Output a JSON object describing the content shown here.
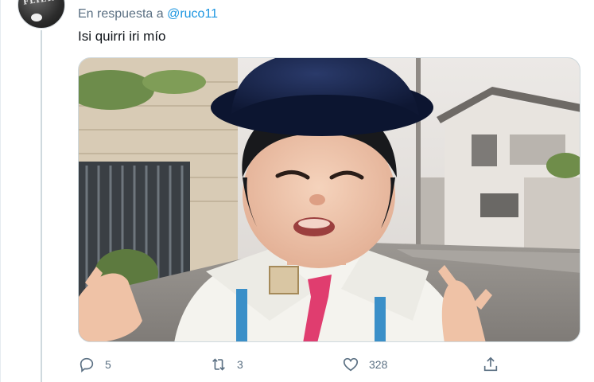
{
  "reply": {
    "prefix": "En respuesta a",
    "handle": "@ruco11"
  },
  "tweet": {
    "text": "Isi quirri iri mío"
  },
  "avatar": {
    "text": "FLIER"
  },
  "actions": {
    "reply_count": "5",
    "retweet_count": "3",
    "like_count": "328"
  },
  "icons": [
    "reply-icon",
    "retweet-icon",
    "like-icon",
    "share-icon"
  ],
  "colors": {
    "secondary_text": "#5b7083",
    "link": "#1b95e0",
    "thread_line": "#cfd9de"
  }
}
